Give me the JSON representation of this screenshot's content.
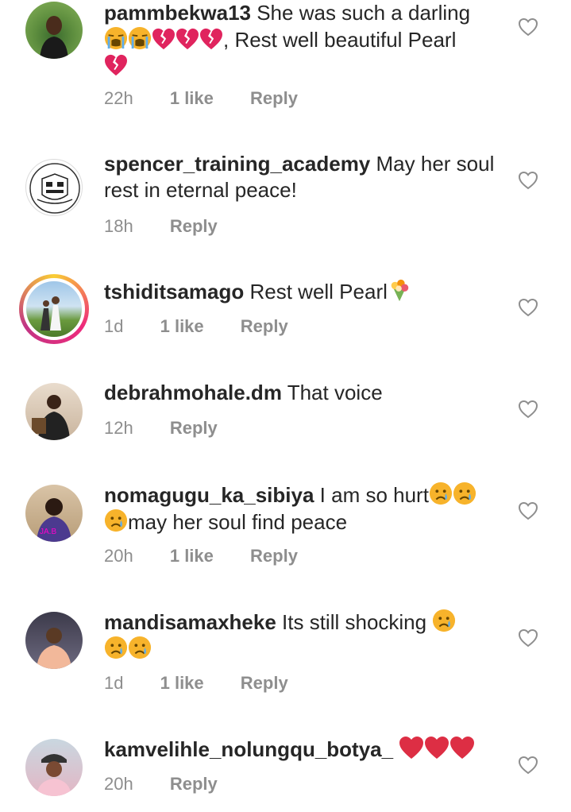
{
  "colors": {
    "text": "#262626",
    "meta": "#8e8e8e",
    "heart_outline": "#8e8e8e",
    "broken_heart": "#e0245e",
    "red_heart": "#dd2e44",
    "sad_emoji": "#f7b32b"
  },
  "comments": [
    {
      "username": "pammbekwa13",
      "text_a": "She was such a darling",
      "text_b": ", Rest well beautiful Pearl",
      "emojis": [
        "loudly-crying-face",
        "loudly-crying-face",
        "broken-heart",
        "broken-heart",
        "broken-heart",
        "broken-heart"
      ],
      "time": "22h",
      "likes": "1 like",
      "reply": "Reply"
    },
    {
      "username": "spencer_training_academy",
      "text": "May her soul rest in eternal peace!",
      "time": "18h",
      "reply": "Reply"
    },
    {
      "username": "tshiditsamago",
      "text": "Rest well Pearl",
      "emojis": [
        "bouquet"
      ],
      "time": "1d",
      "likes": "1 like",
      "reply": "Reply"
    },
    {
      "username": "debrahmohale.dm",
      "text": "That voice",
      "time": "12h",
      "reply": "Reply"
    },
    {
      "username": "nomagugu_ka_sibiya",
      "text_a": "I am so hurt",
      "text_b": "may her soul find peace",
      "emojis": [
        "crying-face",
        "crying-face",
        "crying-face"
      ],
      "time": "20h",
      "likes": "1 like",
      "reply": "Reply"
    },
    {
      "username": "mandisamaxheke",
      "text": "Its still shocking",
      "emojis": [
        "crying-face",
        "crying-face",
        "crying-face"
      ],
      "time": "1d",
      "likes": "1 like",
      "reply": "Reply"
    },
    {
      "username": "kamvelihle_nolungqu_botya_",
      "emojis": [
        "red-heart",
        "red-heart",
        "red-heart"
      ],
      "time": "20h",
      "reply": "Reply"
    }
  ]
}
